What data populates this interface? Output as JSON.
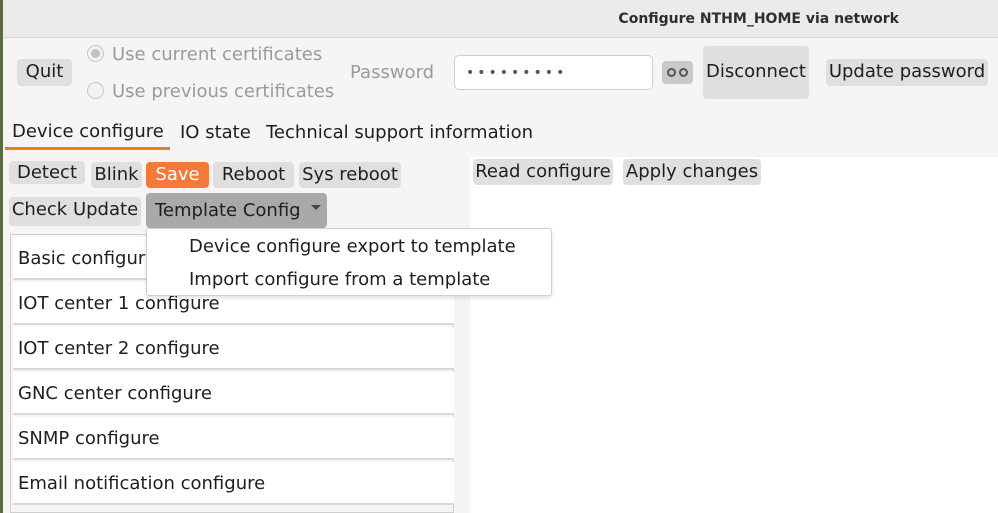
{
  "window": {
    "title": "Configure NTHM_HOME via network"
  },
  "header": {
    "quit_label": "Quit",
    "cert_options": [
      {
        "label": "Use current certificates",
        "checked": true
      },
      {
        "label": "Use previous certificates",
        "checked": false
      }
    ],
    "password_label": "Password",
    "password_value": "•••••••••",
    "show_password_icon": "eye-icon",
    "disconnect_label": "Disconnect",
    "update_password_label": "Update password"
  },
  "tabs": [
    {
      "label": "Device configure",
      "active": true
    },
    {
      "label": "IO state",
      "active": false
    },
    {
      "label": "Technical support information",
      "active": false
    }
  ],
  "toolbar": {
    "detect_label": "Detect",
    "blink_label": "Blink",
    "save_label": "Save",
    "reboot_label": "Reboot",
    "sys_reboot_label": "Sys reboot",
    "check_update_label": "Check Update",
    "template_config_label": "Template Config"
  },
  "template_menu": {
    "items": [
      "Device configure export to template",
      "Import configure from a template"
    ]
  },
  "config_list": {
    "items": [
      "Basic configure",
      "IOT center 1 configure",
      "IOT center 2 configure",
      "GNC center configure",
      "SNMP configure",
      "Email notification configure"
    ]
  },
  "right_toolbar": {
    "read_configure_label": "Read configure",
    "apply_changes_label": "Apply changes"
  },
  "colors": {
    "accent": "#e87d1e",
    "save_button": "#f57a3a"
  }
}
